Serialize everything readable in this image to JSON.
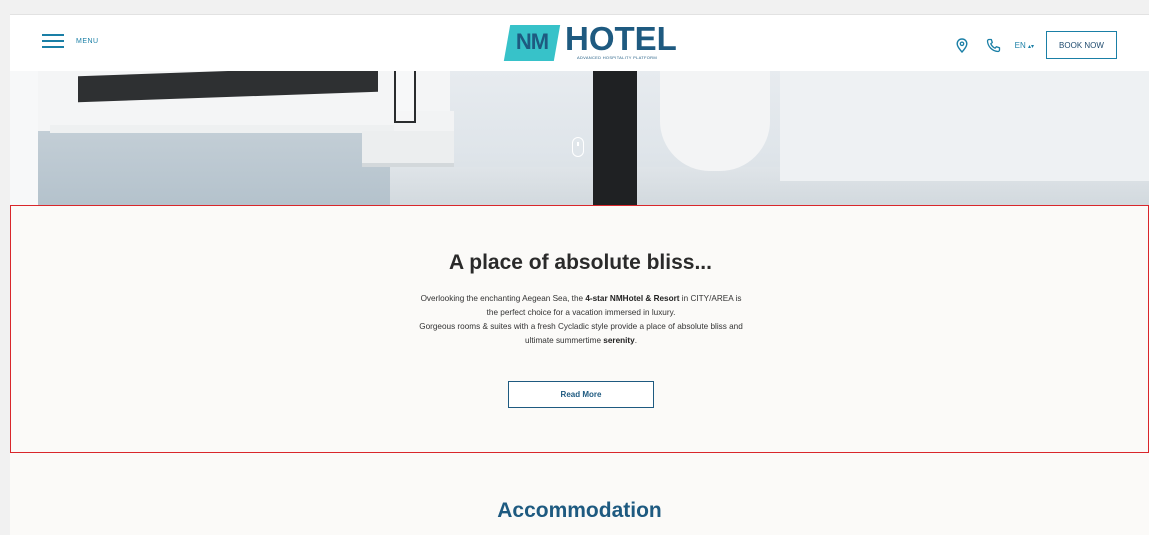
{
  "header": {
    "menu_label": "MENU",
    "logo": {
      "badge": "NM",
      "word": "HOTEL",
      "tagline": "ADVANCED HOSPITALITY PLATFORM"
    },
    "language": "EN",
    "language_caret": "▴▾",
    "book_label": "BOOK NOW",
    "icons": [
      "location-pin-icon",
      "phone-icon"
    ]
  },
  "intro": {
    "title": "A place of absolute bliss...",
    "line1_a": "Overlooking the enchanting Aegean Sea, the ",
    "line1_b": "4-star NMHotel & Resort",
    "line1_c": " in CITY/AREA is",
    "line2": "the perfect choice for a vacation immersed in luxury.",
    "line3": "Gorgeous rooms & suites with a fresh Cycladic style provide a place of absolute bliss and",
    "line4_a": "ultimate summertime ",
    "line4_b": "serenity",
    "line4_c": ".",
    "read_more": "Read More"
  },
  "accommodation": {
    "title": "Accommodation"
  },
  "colors": {
    "accent": "#1a7fa6",
    "brand_dark": "#1e5a80",
    "brand_teal": "#37c2c9",
    "highlight_border": "#d9262b"
  }
}
